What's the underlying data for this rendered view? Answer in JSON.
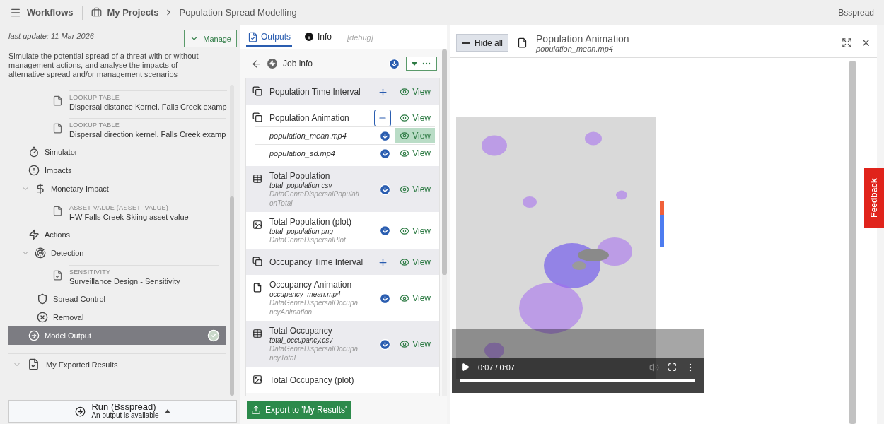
{
  "header": {
    "menu": "Workflows",
    "breadcrumb": [
      "My Projects",
      "Population Spread Modelling"
    ],
    "user": "Bsspread"
  },
  "sidebar": {
    "last_update": "last update: 11 Mar 2026",
    "manage_button": "Manage",
    "description": "Simulate the potential spread of a threat with or without management actions, and analyse the impacts of alternative spread and/or management scenarios",
    "partial_items": [
      {
        "kind": "file",
        "caption": "LOOKUP TABLE",
        "label": "Dispersal distance Kernel. Falls Creek examp",
        "selected": false
      },
      {
        "kind": "file",
        "caption": "LOOKUP TABLE",
        "label": "Dispersal direction kernel. Falls Creek examp",
        "selected": false
      }
    ],
    "tree": [
      {
        "kind": "step",
        "label": "Simulator",
        "selected": false
      },
      {
        "kind": "step",
        "label": "Impacts",
        "selected": false,
        "children": [
          {
            "kind": "step",
            "label": "Monetary Impact",
            "expanded": true,
            "selected": false,
            "children": [
              {
                "kind": "file",
                "caption": "ASSET VALUE (ASSET_VALUE)",
                "label": "HW Falls Creek Skiing asset value",
                "selected": false
              }
            ]
          }
        ]
      },
      {
        "kind": "step",
        "label": "Actions",
        "selected": false,
        "children": [
          {
            "kind": "step",
            "label": "Detection",
            "expanded": true,
            "selected": false,
            "children": [
              {
                "kind": "file",
                "caption": "SENSITIVITY",
                "label": "Surveillance Design - Sensitivity",
                "selected": false
              }
            ]
          },
          {
            "kind": "step",
            "label": "Spread Control",
            "selected": false
          },
          {
            "kind": "step",
            "label": "Removal",
            "selected": false
          }
        ]
      },
      {
        "kind": "step",
        "label": "Model Output",
        "selected": true,
        "done": true
      }
    ],
    "exported": {
      "label": "My Exported Results",
      "expanded": true
    },
    "run_button": {
      "label": "Run (Bsspread)",
      "status": "An output is available"
    }
  },
  "outputs": {
    "tabs": [
      {
        "label": "Outputs",
        "selected": true
      },
      {
        "label": "Info",
        "selected": false
      },
      {
        "label": "[debug]",
        "selected": false
      }
    ],
    "job_info": "Job info",
    "rows": [
      {
        "kind": "group",
        "title": "Population Time Interval",
        "expanded": false,
        "selected": false,
        "view": "View"
      },
      {
        "kind": "group",
        "title": "Population Animation",
        "expanded": true,
        "selected": false,
        "view": "View",
        "children": [
          {
            "file": "population_mean.mp4",
            "selected": true,
            "view": "View"
          },
          {
            "file": "population_sd.mp4",
            "selected": false,
            "view": "View"
          }
        ]
      },
      {
        "kind": "table",
        "title": "Total Population",
        "file": "total_population.csv",
        "genre": "DataGenreDispersalPopulationTotal",
        "selected": false,
        "view": "View"
      },
      {
        "kind": "plot",
        "title": "Total Population (plot)",
        "file": "total_population.png",
        "genre": "DataGenreDispersalPlot",
        "selected": false,
        "view": "View"
      },
      {
        "kind": "group",
        "title": "Occupancy Time Interval",
        "expanded": false,
        "selected": false,
        "view": "View"
      },
      {
        "kind": "file",
        "title": "Occupancy Animation",
        "file": "occupancy_mean.mp4",
        "genre": "DataGenreDispersalOccupancyAnimation",
        "selected": false,
        "view": "View"
      },
      {
        "kind": "table",
        "title": "Total Occupancy",
        "file": "total_occupancy.csv",
        "genre": "DataGenreDispersalOccupancyTotal",
        "selected": false,
        "view": "View"
      },
      {
        "kind": "plot",
        "title": "Total Occupancy (plot)",
        "selected": false
      }
    ],
    "export_button": "Export to 'My Results'"
  },
  "viewer": {
    "hide_button": "Hide all",
    "title": "Population Animation",
    "file": "population_mean.mp4",
    "video": {
      "kind": "picture",
      "time": "0:07 / 0:07",
      "level": 1
    }
  },
  "feedback": "Feedback"
}
